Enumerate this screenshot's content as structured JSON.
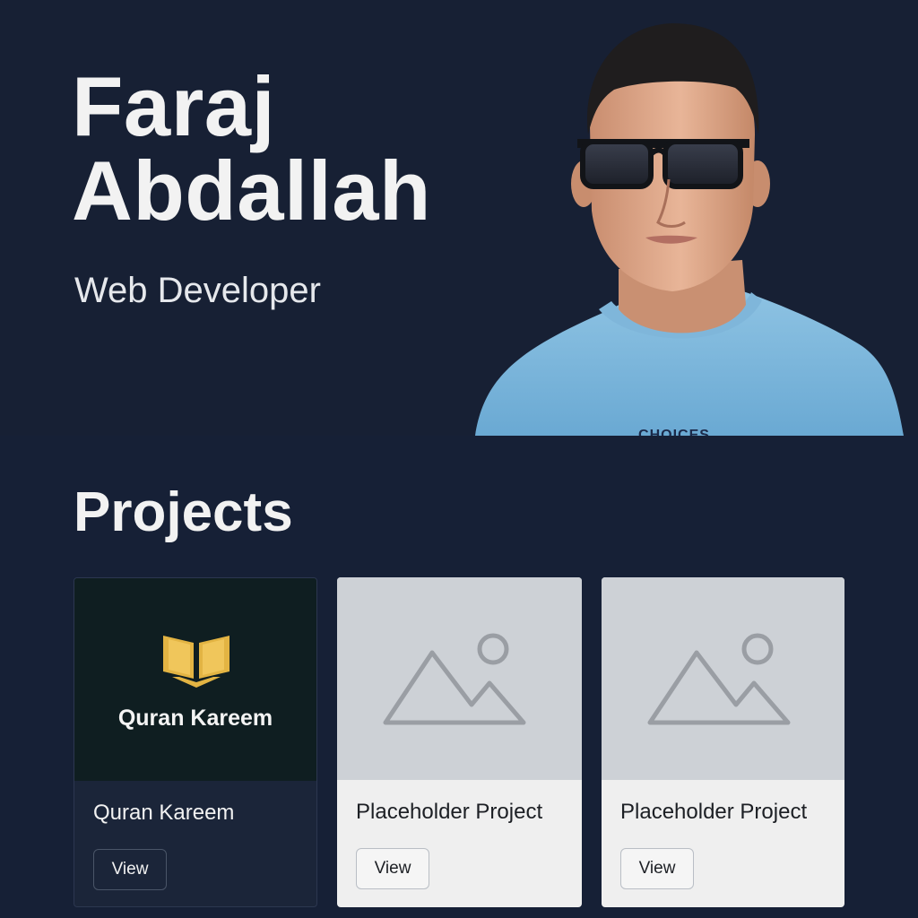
{
  "hero": {
    "first_name": "Faraj",
    "last_name": "Abdallah",
    "role": "Web Developer",
    "shirt_text": "CHOICES"
  },
  "projects": {
    "heading": "Projects",
    "items": [
      {
        "thumb_label": "Quran Kareem",
        "thumb_icon": "open-book-icon",
        "title": "Quran Kareem",
        "button": "View"
      },
      {
        "thumb_icon": "image-placeholder-icon",
        "title": "Placeholder Project",
        "button": "View"
      },
      {
        "thumb_icon": "image-placeholder-icon",
        "title": "Placeholder Project",
        "button": "View"
      }
    ]
  },
  "colors": {
    "background": "#162036",
    "hero_background": "#172034",
    "accent_gold": "#e3b443",
    "card_dark": "#1b2539",
    "card_light": "#efefef",
    "placeholder_thumb": "#cdd1d6"
  }
}
